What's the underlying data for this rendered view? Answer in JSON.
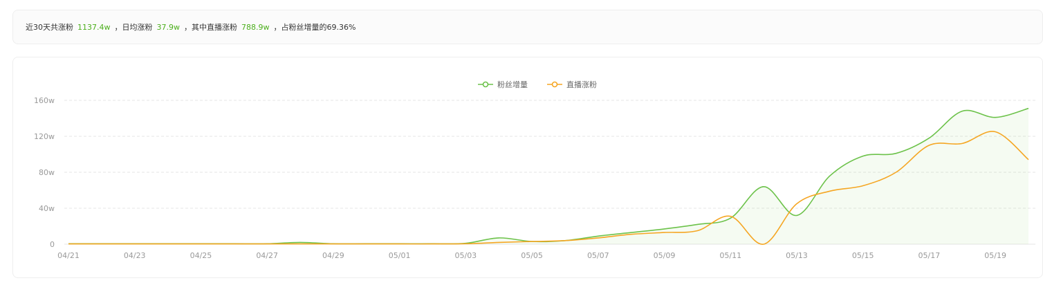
{
  "summary": {
    "prefix": "近30天共涨粉",
    "total_value": "1137.4w",
    "sep1": "，日均涨粉",
    "daily_value": "37.9w",
    "sep2": "，其中直播涨粉",
    "live_value": "788.9w",
    "suffix": "，占粉丝增量的69.36%"
  },
  "colors": {
    "fans": "#6cc24a",
    "live": "#f5a623",
    "grid": "#e6e6e6",
    "axis_text": "#999999",
    "highlight": "#4caf1c"
  },
  "chart_data": {
    "type": "line",
    "x": [
      "04/21",
      "04/22",
      "04/23",
      "04/24",
      "04/25",
      "04/26",
      "04/27",
      "04/28",
      "04/29",
      "04/30",
      "05/01",
      "05/02",
      "05/03",
      "05/04",
      "05/05",
      "05/06",
      "05/07",
      "05/08",
      "05/09",
      "05/10",
      "05/11",
      "05/12",
      "05/13",
      "05/14",
      "05/15",
      "05/16",
      "05/17",
      "05/18",
      "05/19",
      "05/20"
    ],
    "x_tick_labels": [
      "04/21",
      "04/23",
      "04/25",
      "04/27",
      "04/29",
      "05/01",
      "05/03",
      "05/05",
      "05/07",
      "05/09",
      "05/11",
      "05/13",
      "05/15",
      "05/17",
      "05/19"
    ],
    "y_tick_labels": [
      "0",
      "40w",
      "80w",
      "120w",
      "160w"
    ],
    "ylim": [
      0,
      160
    ],
    "y_unit": "w",
    "grid": true,
    "legend_position": "top-center",
    "series": [
      {
        "name": "粉丝增量",
        "color": "#6cc24a",
        "area": true,
        "values": [
          0.5,
          0.5,
          0.5,
          0.5,
          0.5,
          0.5,
          0.5,
          2,
          0.5,
          0.5,
          0.5,
          0.5,
          1,
          7,
          3,
          4,
          9,
          13,
          17,
          22,
          29,
          64,
          32,
          76,
          98,
          101,
          118,
          148,
          141,
          151
        ]
      },
      {
        "name": "直播涨粉",
        "color": "#f5a623",
        "area": false,
        "values": [
          0.3,
          0.3,
          0.3,
          0.3,
          0.3,
          0.3,
          0.3,
          0.3,
          0.3,
          0.3,
          0.3,
          0.3,
          0.5,
          2,
          3,
          4,
          7,
          11,
          13,
          15,
          31,
          0,
          45,
          59,
          65,
          80,
          110,
          112,
          125,
          94
        ]
      }
    ]
  }
}
